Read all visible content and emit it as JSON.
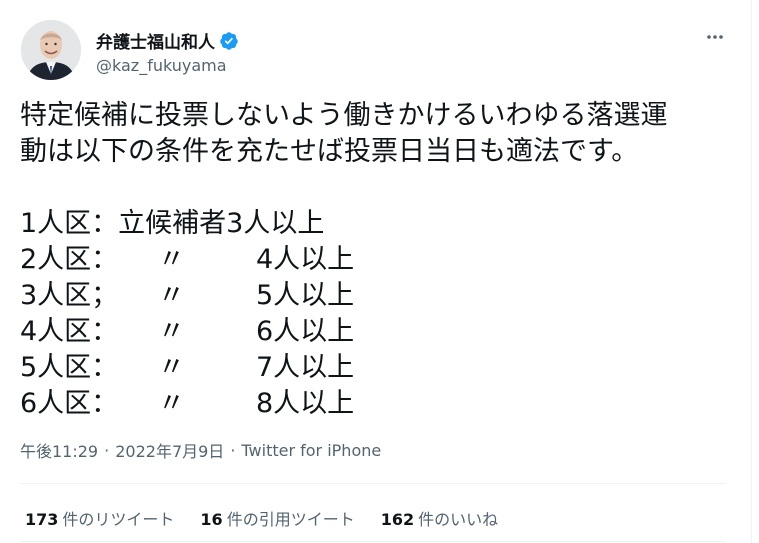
{
  "author": {
    "display_name": "弁護士福山和人",
    "handle": "@kaz_fukuyama",
    "verified_icon": "verified-badge-icon",
    "avatar_icon": "avatar-photo"
  },
  "tweet": {
    "line1": "特定候補に投票しないよう働きかけるいわゆる落選運",
    "line2": "動は以下の条件を充たせば投票日当日も適法です。",
    "first_row": "1人区：立候補者3人以上",
    "rows": [
      {
        "district": "2人区：",
        "ditto": "〃",
        "count": "4人以上"
      },
      {
        "district": "3人区；",
        "ditto": "〃",
        "count": "5人以上"
      },
      {
        "district": "4人区：",
        "ditto": "〃",
        "count": "6人以上"
      },
      {
        "district": "5人区：",
        "ditto": "〃",
        "count": "7人以上"
      },
      {
        "district": "6人区：",
        "ditto": "〃",
        "count": "8人以上"
      }
    ]
  },
  "meta": {
    "time": "午後11:29",
    "separator": "·",
    "date": "2022年7月9日",
    "source": "Twitter for iPhone"
  },
  "stats": {
    "retweets_count": "173",
    "retweets_label": "件のリツイート",
    "quotes_count": "16",
    "quotes_label": "件の引用ツイート",
    "likes_count": "162",
    "likes_label": "件のいいね"
  },
  "colors": {
    "text": "#0f1419",
    "secondary": "#536471",
    "verified": "#1d9bf0",
    "divider": "#eff3f4"
  }
}
